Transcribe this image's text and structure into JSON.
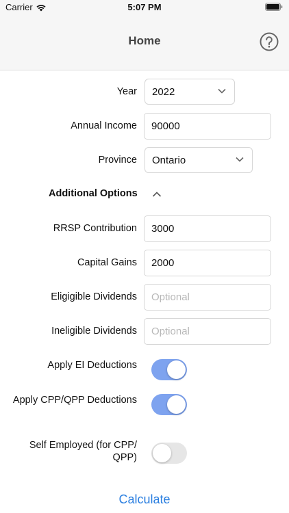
{
  "status_bar": {
    "carrier": "Carrier",
    "time": "5:07 PM"
  },
  "nav": {
    "title": "Home",
    "help_icon": "question-circle-icon"
  },
  "form": {
    "year": {
      "label": "Year",
      "value": "2022"
    },
    "annual_income": {
      "label": "Annual Income",
      "value": "90000"
    },
    "province": {
      "label": "Province",
      "value": "Ontario"
    },
    "additional_options": {
      "label": "Additional Options",
      "expanded": true
    },
    "rrsp": {
      "label": "RRSP Contribution",
      "value": "3000"
    },
    "capital_gains": {
      "label": "Capital Gains",
      "value": "2000"
    },
    "eligible_dividends": {
      "label": "Eligigible Dividends",
      "value": "",
      "placeholder": "Optional"
    },
    "ineligible_dividends": {
      "label": "Ineligible Dividends",
      "value": "",
      "placeholder": "Optional"
    },
    "apply_ei": {
      "label": "Apply EI Deductions",
      "on": true
    },
    "apply_cpp": {
      "label": "Apply CPP/QPP Deductions",
      "on": true
    },
    "self_employed": {
      "label": "Self Employed (for CPP/ QPP)",
      "on": false
    }
  },
  "actions": {
    "calculate_label": "Calculate"
  },
  "colors": {
    "accent": "#2b7fe0",
    "toggle_on": "#7ea3ef",
    "toggle_off": "#e6e6e6"
  }
}
